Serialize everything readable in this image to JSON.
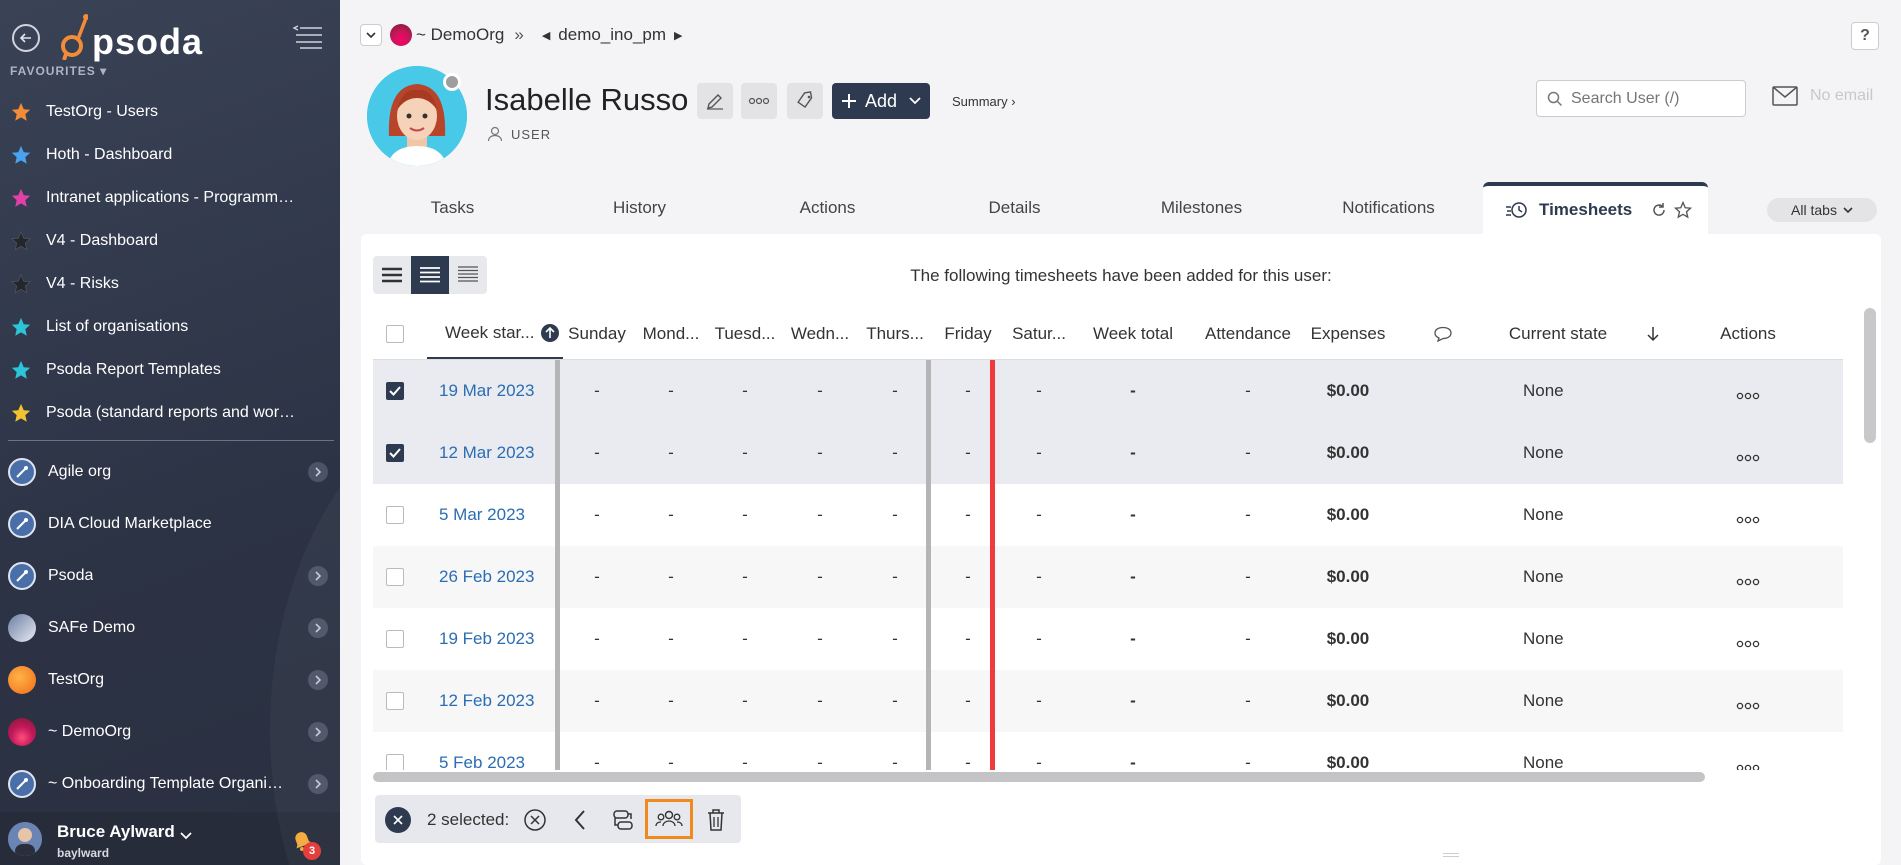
{
  "sidebar": {
    "logo_text": "psoda",
    "favourites_header": "FAVOURITES",
    "favourites": [
      {
        "label": "TestOrg - Users",
        "color": "#f28c38"
      },
      {
        "label": "Hoth - Dashboard",
        "color": "#4aa3f0"
      },
      {
        "label": "Intranet applications - Programme...",
        "color": "#e040a8"
      },
      {
        "label": "V4 - Dashboard",
        "color": "#2a2f3a"
      },
      {
        "label": "V4 - Risks",
        "color": "#2a2f3a"
      },
      {
        "label": "List of organisations",
        "color": "#2bc4d8"
      },
      {
        "label": "Psoda Report Templates",
        "color": "#2bc4d8"
      },
      {
        "label": "Psoda (standard reports and work...",
        "color": "#f2c230"
      }
    ],
    "orgs": [
      {
        "label": "Agile org",
        "has_children": true
      },
      {
        "label": "DIA Cloud Marketplace",
        "has_children": false
      },
      {
        "label": "Psoda",
        "has_children": true
      },
      {
        "label": "SAFe Demo",
        "has_children": true
      },
      {
        "label": "TestOrg",
        "has_children": true
      },
      {
        "label": "~ DemoOrg",
        "has_children": true
      },
      {
        "label": "~ Onboarding Template Organisa...",
        "has_children": true
      }
    ],
    "user": {
      "name": "Bruce Aylward",
      "handle": "baylward",
      "notifications": "3"
    }
  },
  "breadcrumb": {
    "org": "~ DemoOrg",
    "separator": "»",
    "project": "demo_ino_pm"
  },
  "help_label": "?",
  "profile": {
    "name": "Isabelle Russo",
    "role": "USER",
    "add_label": "Add",
    "summary_label": "Summary ›",
    "search_placeholder": "Search User (/)",
    "email": "No email"
  },
  "tabs": [
    {
      "label": "Tasks"
    },
    {
      "label": "History"
    },
    {
      "label": "Actions"
    },
    {
      "label": "Details"
    },
    {
      "label": "Milestones"
    },
    {
      "label": "Notifications"
    },
    {
      "label": "Timesheets"
    }
  ],
  "all_tabs_label": "All tabs",
  "panel_message": "The following timesheets have been added for this user:",
  "table": {
    "headers": {
      "week": "Week star...",
      "sun": "Sunday",
      "mon": "Mond...",
      "tue": "Tuesd...",
      "wed": "Wedn...",
      "thu": "Thurs...",
      "fri": "Friday",
      "sat": "Satur...",
      "total": "Week total",
      "attendance": "Attendance",
      "expenses": "Expenses",
      "state": "Current state",
      "actions": "Actions"
    },
    "rows": [
      {
        "week": "19 Mar 2023",
        "sun": "-",
        "mon": "-",
        "tue": "-",
        "wed": "-",
        "thu": "-",
        "fri": "-",
        "sat": "-",
        "total": "-",
        "attendance": "-",
        "expenses": "$0.00",
        "state": "None",
        "selected": true
      },
      {
        "week": "12 Mar 2023",
        "sun": "-",
        "mon": "-",
        "tue": "-",
        "wed": "-",
        "thu": "-",
        "fri": "-",
        "sat": "-",
        "total": "-",
        "attendance": "-",
        "expenses": "$0.00",
        "state": "None",
        "selected": true
      },
      {
        "week": "5 Mar 2023",
        "sun": "-",
        "mon": "-",
        "tue": "-",
        "wed": "-",
        "thu": "-",
        "fri": "-",
        "sat": "-",
        "total": "-",
        "attendance": "-",
        "expenses": "$0.00",
        "state": "None",
        "selected": false
      },
      {
        "week": "26 Feb 2023",
        "sun": "-",
        "mon": "-",
        "tue": "-",
        "wed": "-",
        "thu": "-",
        "fri": "-",
        "sat": "-",
        "total": "-",
        "attendance": "-",
        "expenses": "$0.00",
        "state": "None",
        "selected": false
      },
      {
        "week": "19 Feb 2023",
        "sun": "-",
        "mon": "-",
        "tue": "-",
        "wed": "-",
        "thu": "-",
        "fri": "-",
        "sat": "-",
        "total": "-",
        "attendance": "-",
        "expenses": "$0.00",
        "state": "None",
        "selected": false
      },
      {
        "week": "12 Feb 2023",
        "sun": "-",
        "mon": "-",
        "tue": "-",
        "wed": "-",
        "thu": "-",
        "fri": "-",
        "sat": "-",
        "total": "-",
        "attendance": "-",
        "expenses": "$0.00",
        "state": "None",
        "selected": false
      },
      {
        "week": "5 Feb 2023",
        "sun": "-",
        "mon": "-",
        "tue": "-",
        "wed": "-",
        "thu": "-",
        "fri": "-",
        "sat": "-",
        "total": "-",
        "attendance": "-",
        "expenses": "$0.00",
        "state": "None",
        "selected": false
      }
    ]
  },
  "bulk": {
    "selected_label": "2 selected:"
  },
  "colors": {
    "accent": "#2e3a4f",
    "link": "#2a6db3",
    "highlight": "#f08a1c",
    "week_marker": "#ef3b3b"
  }
}
